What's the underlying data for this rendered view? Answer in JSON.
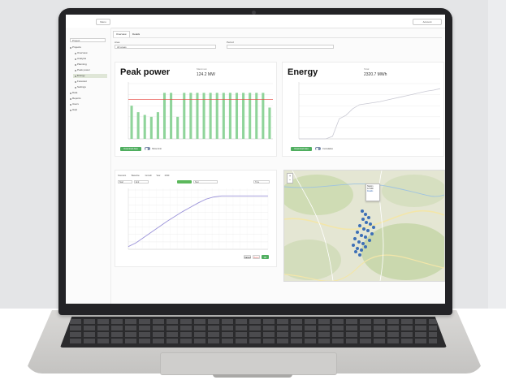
{
  "topbar": {
    "menu_label": "Menu",
    "user_label": "Account"
  },
  "sidebar": {
    "project_select": "Project",
    "items": [
      {
        "label": "Projects",
        "indent": 0
      },
      {
        "label": "Overview",
        "indent": 1
      },
      {
        "label": "Analysis",
        "indent": 1
      },
      {
        "label": "Planning",
        "indent": 1
      },
      {
        "label": "Peak power",
        "indent": 1
      },
      {
        "label": "Energy",
        "indent": 1,
        "active": true
      },
      {
        "label": "Forecast",
        "indent": 1
      },
      {
        "label": "Settings",
        "indent": 1
      },
      {
        "label": "Data",
        "indent": 0
      },
      {
        "label": "Reports",
        "indent": 0
      },
      {
        "label": "Users",
        "indent": 0
      },
      {
        "label": "Help",
        "indent": 0
      }
    ]
  },
  "tabs": [
    "Overview",
    "Details"
  ],
  "filters": {
    "field1_label": "Area",
    "field1_value": "All areas",
    "field2_label": "Period",
    "field2_value": ""
  },
  "peak_card": {
    "title": "Peak power",
    "stat_label": "Maximum",
    "stat_value": "124.2 MW",
    "button_label": "Download data",
    "toggle_label": "Show limit"
  },
  "energy_card": {
    "title": "Energy",
    "stat_label": "Total",
    "stat_value": "2320.7 MWh",
    "button_label": "Download data",
    "toggle_label": "Cumulative"
  },
  "scenario": {
    "controls": [
      "Scenario",
      "Baseline",
      "Growth",
      "Year",
      "2030"
    ],
    "field_labels": [
      "Start",
      "End",
      "Step",
      "Type"
    ],
    "cancel_label": "Cancel",
    "reset_label": "Reset",
    "ok_label": "OK"
  },
  "map": {
    "popup_lines": [
      "Station",
      "12 MW",
      "Details"
    ],
    "zoom_in": "+",
    "zoom_out": "−"
  },
  "chart_data": [
    {
      "type": "bar",
      "title": "Peak power",
      "categories": [
        "1",
        "2",
        "3",
        "4",
        "5",
        "6",
        "7",
        "8",
        "9",
        "10",
        "11",
        "12",
        "13",
        "14",
        "15",
        "16",
        "17",
        "18",
        "19",
        "20",
        "21",
        "22"
      ],
      "values": [
        72,
        58,
        52,
        48,
        58,
        100,
        100,
        48,
        100,
        100,
        100,
        100,
        100,
        100,
        100,
        100,
        100,
        100,
        100,
        100,
        100,
        68
      ],
      "limit": 86,
      "ylim": [
        0,
        120
      ],
      "colors": {
        "bar": "#8fd49a",
        "limit": "#e8423a"
      }
    },
    {
      "type": "line",
      "title": "Energy",
      "x": [
        0,
        1,
        2,
        3,
        4,
        5,
        6,
        7,
        8,
        9,
        10,
        11,
        12,
        13,
        14,
        15,
        16,
        17,
        18,
        19,
        20,
        21
      ],
      "values": [
        0,
        0,
        0,
        0,
        0,
        5,
        40,
        47,
        60,
        68,
        70,
        72,
        74,
        77,
        80,
        83,
        86,
        89,
        92,
        95,
        97,
        100
      ],
      "ylim": [
        0,
        110
      ],
      "colors": {
        "line": "#c9c9d3"
      }
    },
    {
      "type": "line",
      "x": [
        0,
        1,
        2,
        3,
        4,
        5,
        6,
        7,
        8,
        9,
        10,
        11,
        12,
        13,
        14,
        15,
        16,
        17,
        18
      ],
      "values": [
        5,
        12,
        22,
        32,
        42,
        52,
        61,
        70,
        78,
        86,
        93,
        97,
        99,
        99,
        99,
        99,
        99,
        99,
        99
      ],
      "ylim": [
        0,
        110
      ],
      "colors": {
        "line": "#9b93d9"
      }
    }
  ]
}
